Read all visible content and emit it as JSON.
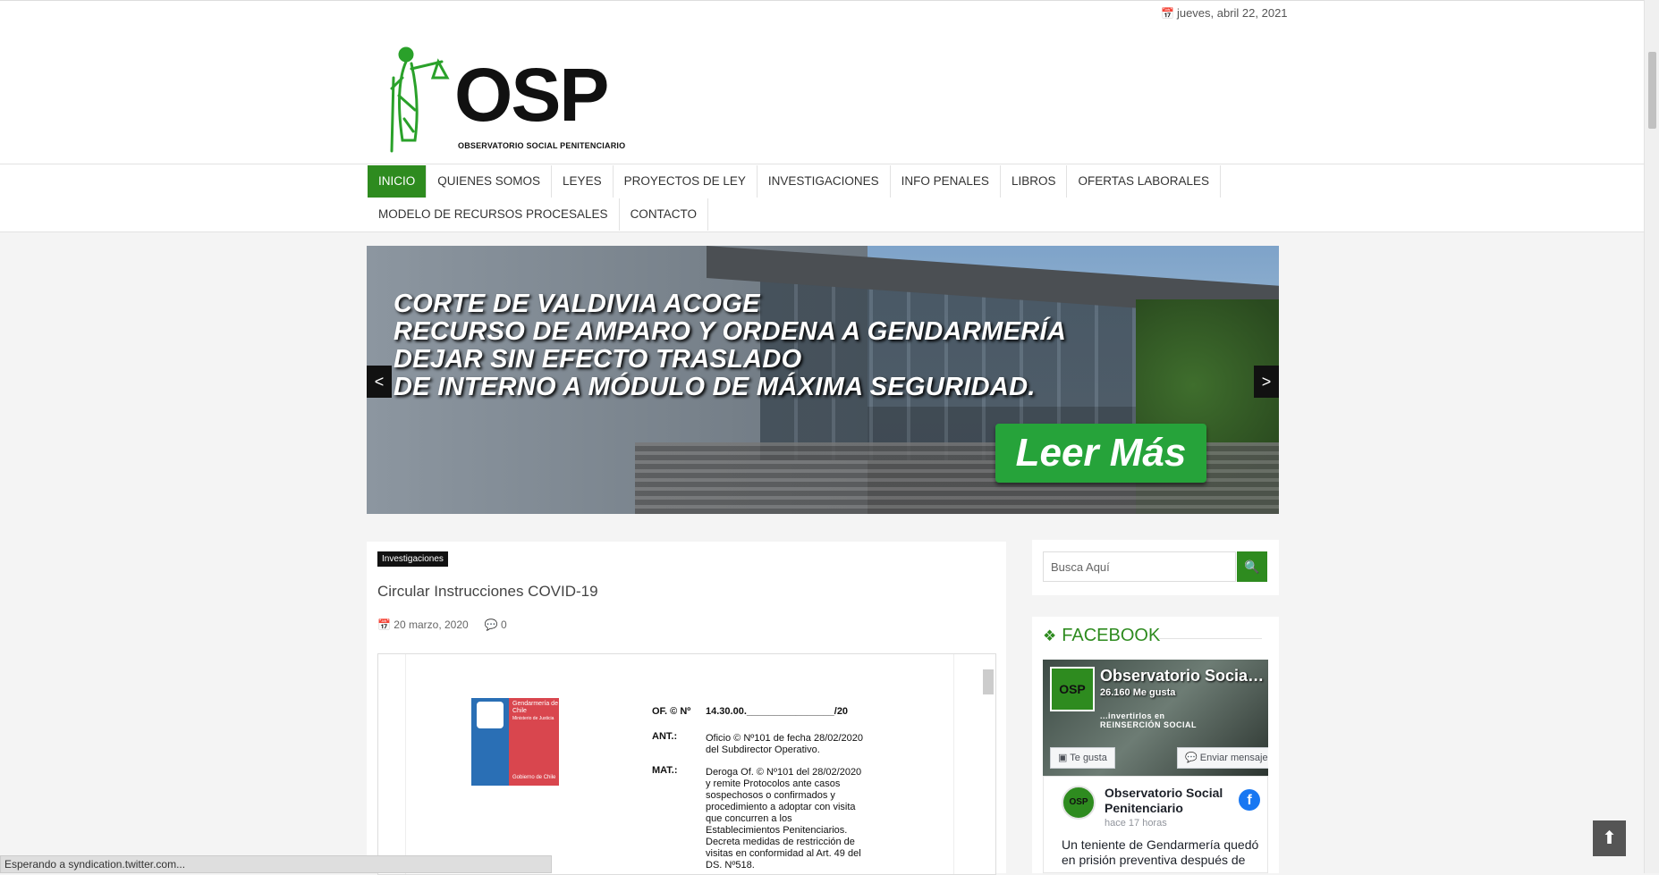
{
  "topbar": {
    "date": "jueves, abril 22, 2021"
  },
  "logo": {
    "text": "OSP",
    "subtitle": "OBSERVATORIO SOCIAL PENITENCIARIO"
  },
  "nav": {
    "row1": [
      "INICIO",
      "QUIENES SOMOS",
      "LEYES",
      "PROYECTOS DE LEY",
      "INVESTIGACIONES",
      "INFO PENALES",
      "LIBROS",
      "OFERTAS LABORALES"
    ],
    "row2": [
      "MODELO DE RECURSOS PROCESALES",
      "CONTACTO"
    ],
    "active": "INICIO",
    "accent": "#2e8b1f"
  },
  "slider": {
    "headline": [
      "CORTE DE VALDIVIA ACOGE",
      "RECURSO DE AMPARO Y ORDENA A GENDARMERÍA",
      "DEJAR SIN EFECTO TRASLADO",
      "DE INTERNO A MÓDULO DE MÁXIMA SEGURIDAD."
    ],
    "button": "Leer Más",
    "prev": "<",
    "next": ">"
  },
  "post": {
    "category": "Investigaciones",
    "title": "Circular Instrucciones COVID-19",
    "date": "20 marzo, 2020",
    "comments": "0",
    "document": {
      "org_title": "Gendarmería de Chile",
      "org_sub": "Ministerio de Justicia",
      "org_footer": "Gobierno de Chile",
      "of_label": "OF. © Nº",
      "of_value": "14.30.00.________________/20",
      "ant_label": "ANT.:",
      "ant_text": [
        "Oficio © Nº101 de fecha 28/02/2020",
        "del Subdirector Operativo."
      ],
      "mat_label": "MAT.:",
      "mat_text": [
        "Deroga Of. © Nº101 del 28/02/2020",
        "y remite Protocolos ante casos",
        "sospechosos o confirmados y",
        "procedimiento a adoptar con visita",
        "que concurren a los",
        "Establecimientos Penitenciarios.",
        "Decreta medidas de restricción de",
        "visitas en conformidad al Art. 49 del",
        "DS. Nº518."
      ]
    }
  },
  "sidebar": {
    "search_placeholder": "Busca Aquí",
    "facebook": {
      "heading": "FACEBOOK",
      "page_name": "Observatorio Social Penitenciario",
      "cover_name": "Observatorio Social...",
      "likes": "26.160 Me gusta",
      "cover_banner": [
        "...invertirlos en",
        "REINSERCIÓN SOCIAL"
      ],
      "like_button": "Te gusta",
      "message_button": "Enviar mensaje",
      "post_name": "Observatorio Social Penitenciario",
      "post_time": "hace 17 horas",
      "post_text": "Un teniente de Gendarmería quedó en prisión preventiva después de"
    }
  },
  "status_bar": "Esperando a syndication.twitter.com...",
  "icons": {
    "calendar": "calendar-icon",
    "comments": "comments-icon",
    "search": "search-icon",
    "facebook": "facebook-icon",
    "scroll_top": "arrow-up-icon"
  }
}
